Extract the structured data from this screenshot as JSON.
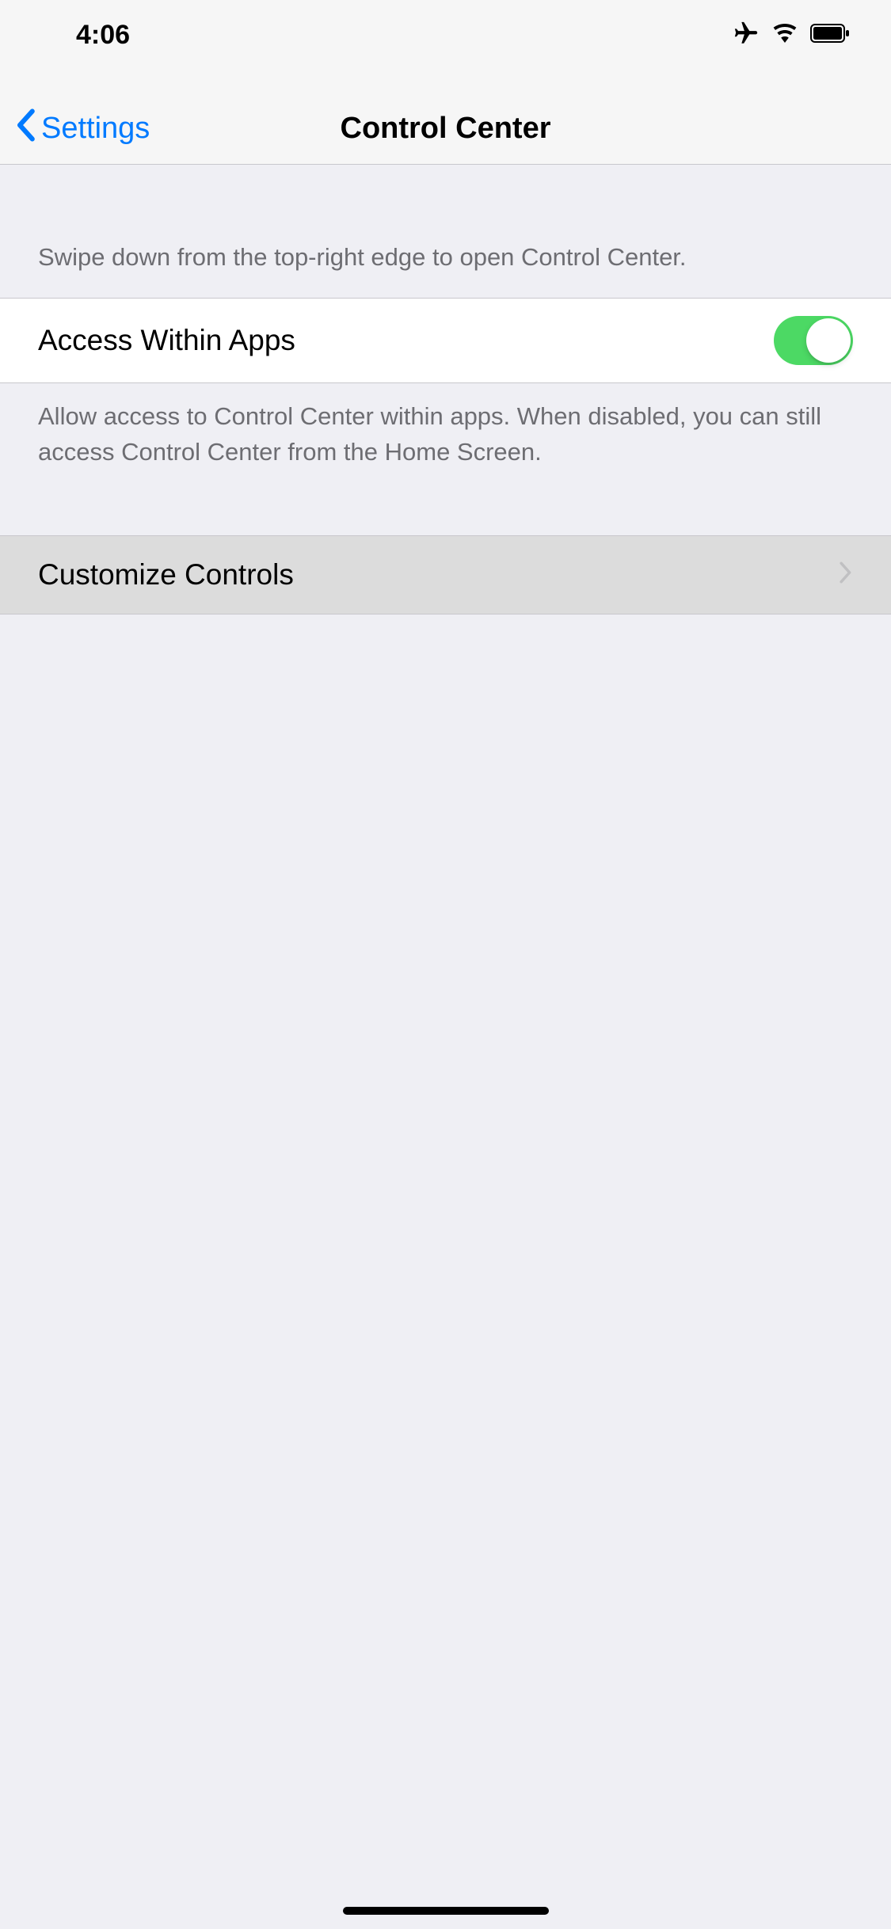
{
  "statusBar": {
    "time": "4:06"
  },
  "navBar": {
    "backLabel": "Settings",
    "title": "Control Center"
  },
  "section1": {
    "header": "Swipe down from the top-right edge to open Control Center.",
    "accessLabel": "Access Within Apps",
    "accessEnabled": true,
    "footer": "Allow access to Control Center within apps. When disabled, you can still access Control Center from the Home Screen."
  },
  "section2": {
    "customizeLabel": "Customize Controls"
  }
}
